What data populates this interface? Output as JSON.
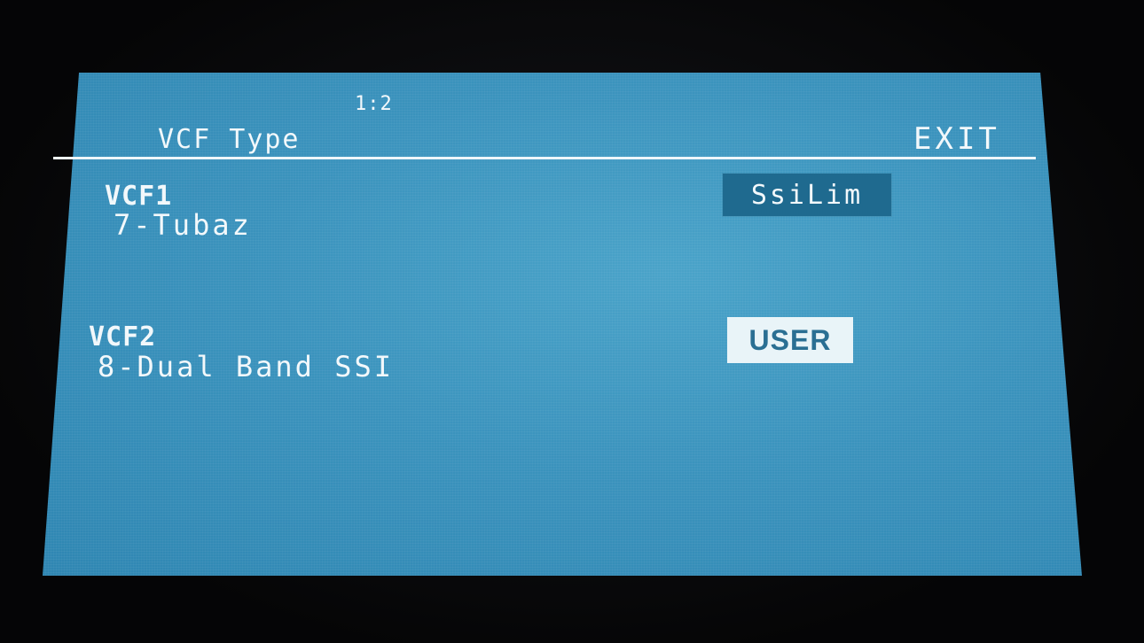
{
  "header": {
    "page_indicator": "1:2",
    "title": "VCF Type",
    "exit_label": "EXIT"
  },
  "params": [
    {
      "label": "VCF1",
      "value": "7-Tubaz",
      "option": "SsiLim"
    },
    {
      "label": "VCF2",
      "value": "8-Dual Band SSI",
      "option": "USER"
    }
  ],
  "colors": {
    "screen": "#3b93bd",
    "text": "#f2f8fb",
    "chip_dark": "#1f6a8f",
    "chip_light": "#e9f4f8"
  }
}
